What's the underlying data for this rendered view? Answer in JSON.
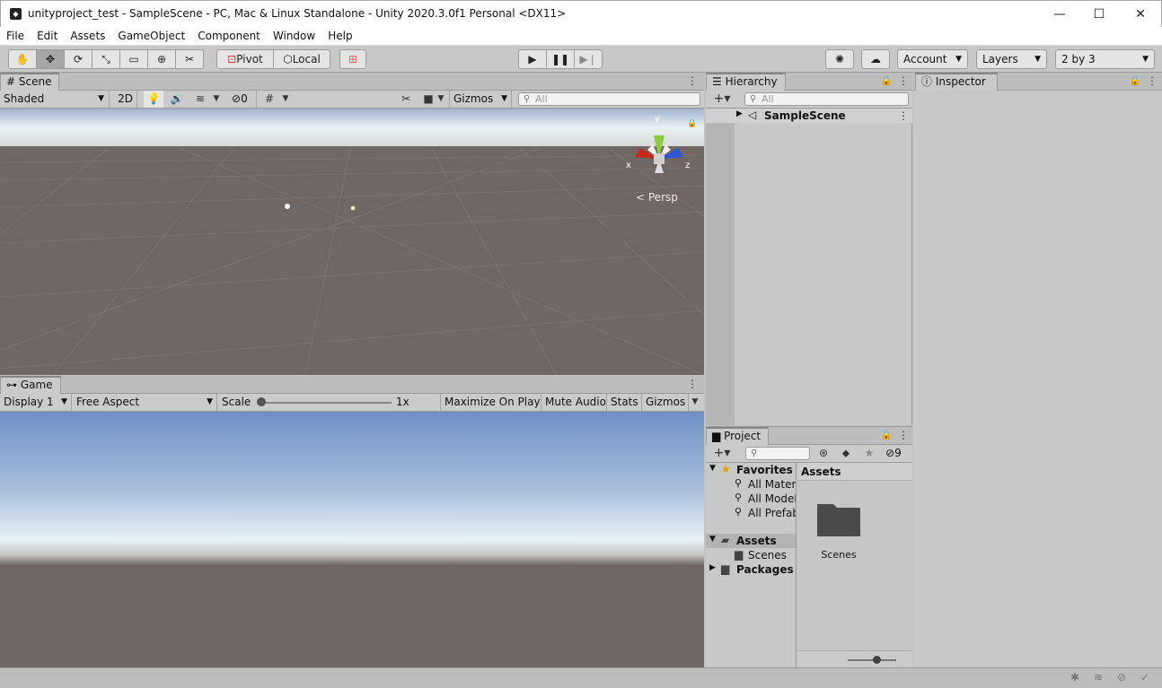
{
  "window": {
    "title": "unityproject_test - SampleScene - PC, Mac & Linux Standalone - Unity 2020.3.0f1 Personal <DX11>",
    "minimize": "—",
    "maximize": "☐",
    "close": "✕"
  },
  "menu": [
    "File",
    "Edit",
    "Assets",
    "GameObject",
    "Component",
    "Window",
    "Help"
  ],
  "toolbar": {
    "pivot": "Pivot",
    "local": "Local",
    "account": "Account",
    "layers": "Layers",
    "layout": "2 by 3"
  },
  "scene": {
    "tab": "Scene",
    "shading": "Shaded",
    "mode2d": "2D",
    "hidden_count": "0",
    "gizmos": "Gizmos",
    "search_placeholder": "All",
    "persp": "Persp",
    "axis_x": "x",
    "axis_y": "y",
    "axis_z": "z"
  },
  "game": {
    "tab": "Game",
    "display": "Display 1",
    "aspect": "Free Aspect",
    "scale_label": "Scale",
    "scale_value": "1x",
    "maximize": "Maximize On Play",
    "mute": "Mute Audio",
    "stats": "Stats",
    "gizmos": "Gizmos"
  },
  "hierarchy": {
    "tab": "Hierarchy",
    "search_placeholder": "All",
    "scene_name": "SampleScene"
  },
  "inspector": {
    "tab": "Inspector"
  },
  "project": {
    "tab": "Project",
    "hidden_count": "9",
    "favorites_label": "Favorites",
    "favorites": [
      "All Materi",
      "All Model",
      "All Prefab"
    ],
    "assets_label": "Assets",
    "assets_children": [
      "Scenes"
    ],
    "packages_label": "Packages",
    "breadcrumb": "Assets",
    "items": [
      {
        "name": "Scenes"
      }
    ]
  },
  "colors": {
    "sky_top": "#7a93c6",
    "horizon": "#e9f2f7",
    "ground": "#6f6561"
  }
}
